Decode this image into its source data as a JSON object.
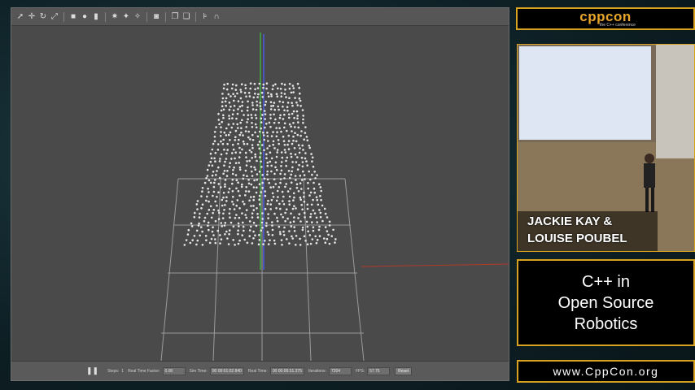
{
  "toolbar": {
    "icons": [
      "select-icon",
      "translate-icon",
      "rotate-icon",
      "scale-icon",
      "box-icon",
      "sphere-icon",
      "cylinder-icon",
      "pointlight-icon",
      "spotlight-icon",
      "dirlight-icon",
      "screenshot-icon",
      "copy-icon",
      "paste-icon",
      "align-icon",
      "magnet-icon"
    ]
  },
  "statusbar": {
    "pause_icon": "❚❚",
    "steps_label": "Steps:",
    "steps_value": "1",
    "rtf_label": "Real Time Factor:",
    "rtf_value": "0.00",
    "simtime_label": "Sim Time:",
    "simtime_value": "00 00:01:02.840",
    "realtime_label": "Real Time:",
    "realtime_value": "00 00:00:31.375",
    "iterations_label": "Iterations:",
    "iterations_value": "7204",
    "fps_label": "FPS:",
    "fps_value": "57.75",
    "reset_label": "Reset"
  },
  "sidebar": {
    "logo_text": "cppcon",
    "logo_sub": "the C++ conference",
    "speaker_line1": "JACKIE KAY &",
    "speaker_line2": "LOUISE POUBEL",
    "talk_title_line1": "C++ in",
    "talk_title_line2": "Open Source",
    "talk_title_line3": "Robotics",
    "url": "www.CppCon.org"
  },
  "colors": {
    "accent_gold": "#d6a21f",
    "logo_orange": "#e8a62a",
    "viewport_bg": "#4a4a4a",
    "axis_green": "#3fae3f",
    "axis_blue": "#4a5ae0",
    "axis_red": "#b03a2a"
  }
}
